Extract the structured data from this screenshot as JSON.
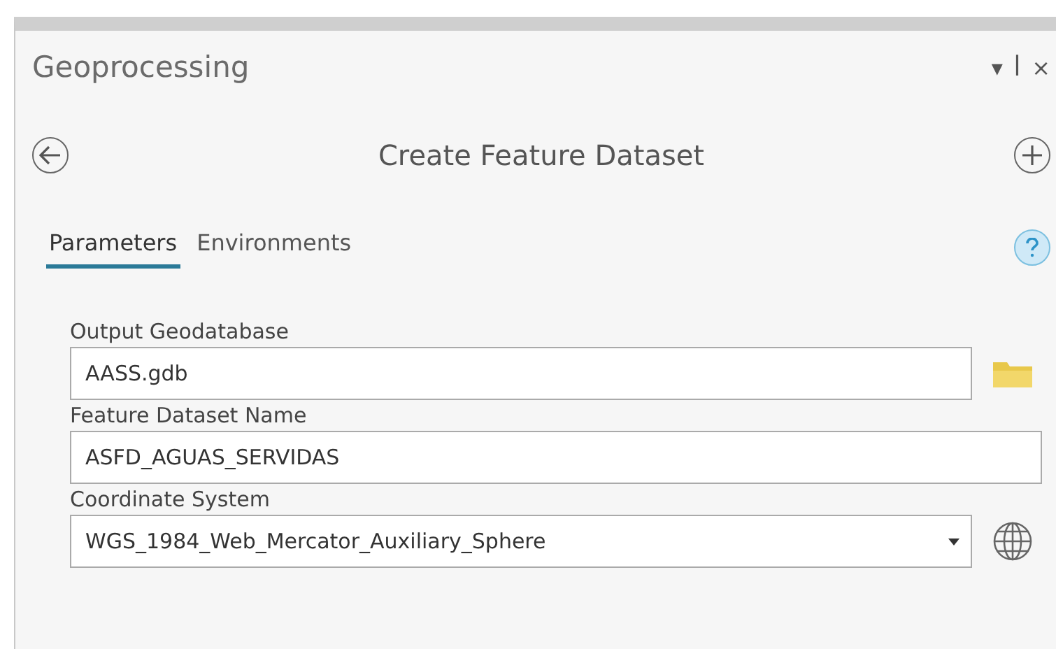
{
  "pane": {
    "title": "Geoprocessing",
    "pane_icons": [
      "▾",
      "ꟾ",
      "×"
    ]
  },
  "tool": {
    "title": "Create Feature Dataset"
  },
  "tabs": [
    {
      "label": "Parameters",
      "selected": true
    },
    {
      "label": "Environments",
      "selected": false
    }
  ],
  "parameters": [
    {
      "kind": "folder",
      "label": "Output Geodatabase",
      "value": "AASS.gdb"
    },
    {
      "kind": "text",
      "label": "Feature Dataset Name",
      "value": "ASFD_AGUAS_SERVIDAS"
    },
    {
      "kind": "dropdown",
      "label": "Coordinate System",
      "value": "WGS_1984_Web_Mercator_Auxiliary_Sphere"
    }
  ]
}
